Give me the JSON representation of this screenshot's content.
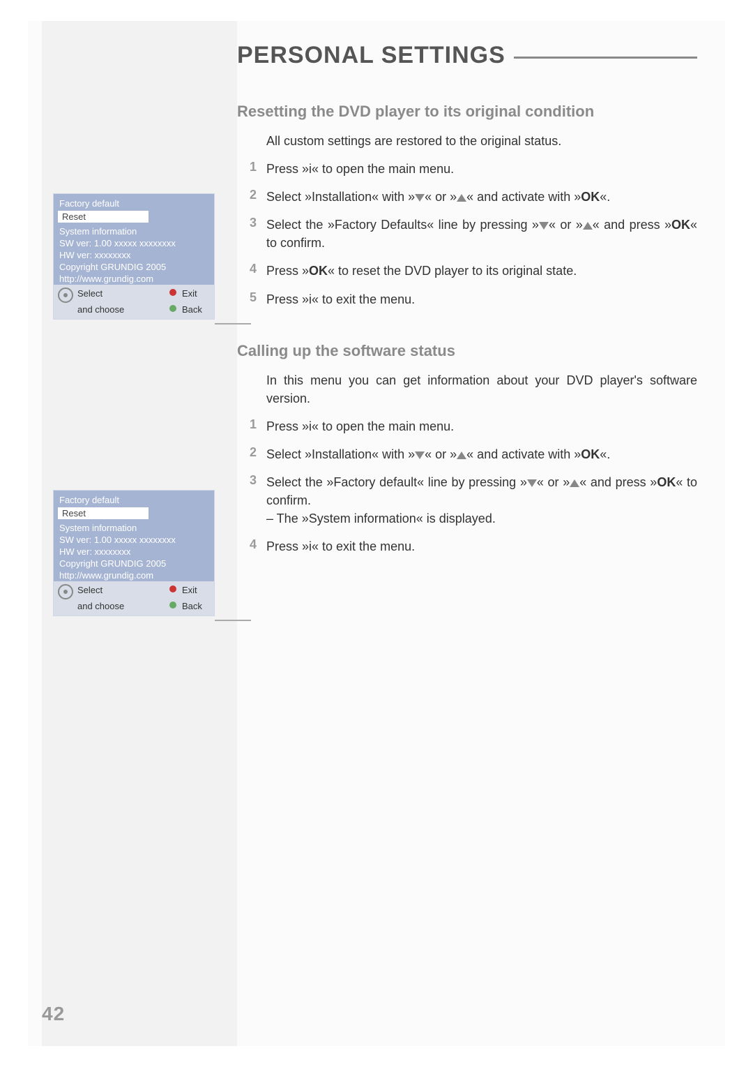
{
  "page_number": "42",
  "page_title": "PERSONAL SETTINGS",
  "section1": {
    "heading": "Resetting the DVD player to its original condition",
    "intro": "All custom settings are restored to the original status.",
    "steps": {
      "s1": "Press »i« to open the main menu.",
      "s2a": "Select »Installation« with »",
      "s2b": "« or »",
      "s2c": "« and activate with »",
      "s2d": "«.",
      "s3a": "Select the »Factory Defaults« line by pressing »",
      "s3b": "« or »",
      "s3c": "« and press »",
      "s3d": "« to confirm.",
      "s4a": "Press »",
      "s4b": "« to reset the DVD player to its original state.",
      "s5": "Press »i« to exit the menu."
    },
    "ok": "OK"
  },
  "section2": {
    "heading": "Calling up the software status",
    "intro": "In this menu you can get information about your DVD player's software version.",
    "steps": {
      "s1": "Press »i« to open the main menu.",
      "s2a": "Select »Installation« with »",
      "s2b": "« or »",
      "s2c": "« and activate with »",
      "s2d": "«.",
      "s3a": "Select the »Factory default« line by pressing »",
      "s3b": "« or »",
      "s3c": "« and press »",
      "s3d": "« to confirm.",
      "s3e": "– The »System information« is displayed.",
      "s4": "Press »i« to exit the menu."
    },
    "ok": "OK"
  },
  "osd": {
    "factory_default": "Factory default",
    "reset": "Reset",
    "sys_info": "System information",
    "sw": "SW ver: 1.00 xxxxx   xxxxxxxx",
    "hw": "HW ver: xxxxxxxx",
    "copyright": "Copyright GRUNDIG 2005",
    "url": "http://www.grundig.com",
    "select": "Select",
    "and_choose": "and choose",
    "exit": "Exit",
    "back": "Back"
  },
  "nums": {
    "n1": "1",
    "n2": "2",
    "n3": "3",
    "n4": "4",
    "n5": "5"
  }
}
